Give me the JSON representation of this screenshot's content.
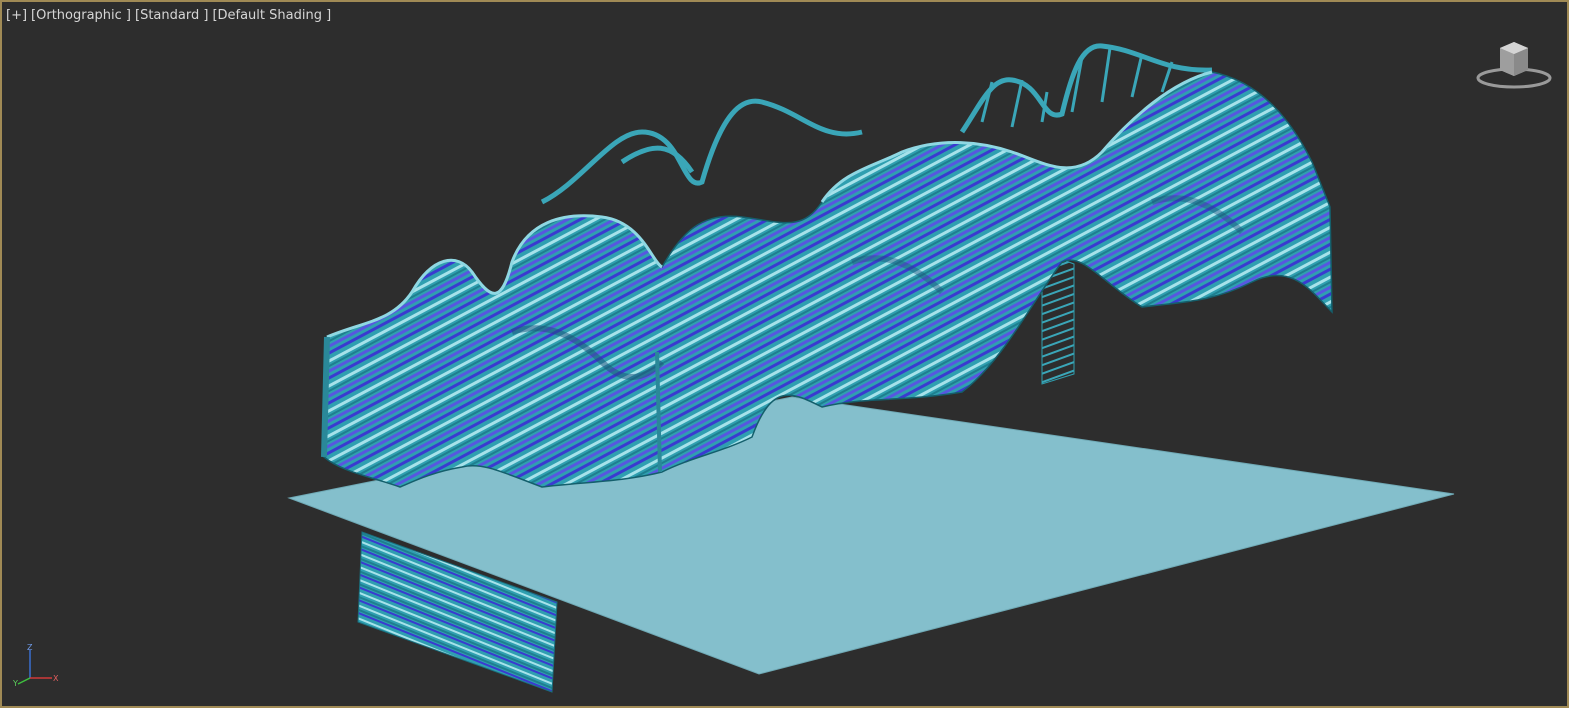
{
  "viewport": {
    "labels": [
      "[+]",
      "[Orthographic ]",
      "[Standard ]",
      "[Default Shading ]"
    ],
    "colors": {
      "background": "#2d2d2d",
      "border": "#a08a55",
      "ground": "#84bfcc",
      "stripe_teal": "#2f9fb0",
      "stripe_blue": "#3f3fd0",
      "stripe_light": "#a6e2ea"
    }
  },
  "viewcube": {
    "icon": "viewcube-icon"
  },
  "axis": {
    "labels": [
      "Z",
      "Y",
      "X"
    ]
  }
}
